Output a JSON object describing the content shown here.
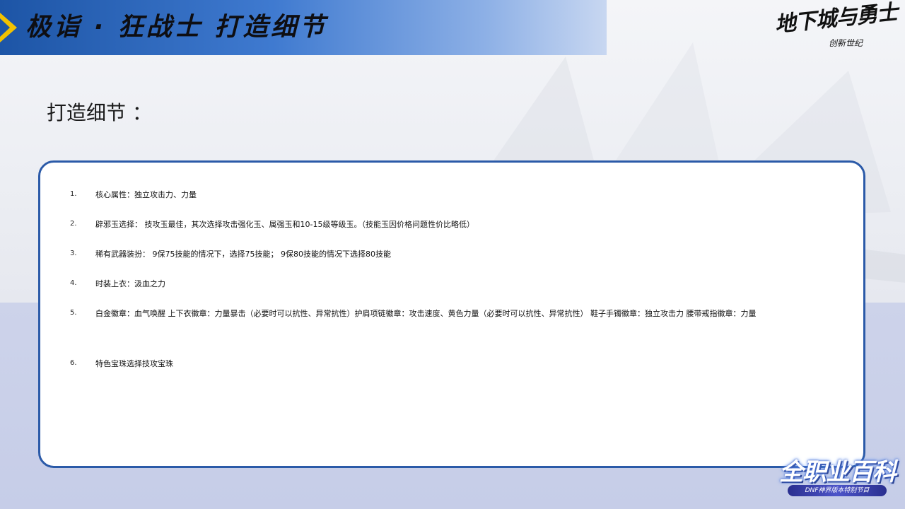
{
  "header": {
    "title": "极诣 · 狂战士  打造细节"
  },
  "logo": {
    "main": "地下城与勇士",
    "sub": "创新世纪"
  },
  "section": {
    "heading": "打造细节 ："
  },
  "items": [
    {
      "num": "1.",
      "text": "核心属性：独立攻击力、力量"
    },
    {
      "num": "2.",
      "text": "辟邪玉选择： 技攻玉最佳，其次选择攻击强化玉、属强玉和10-15级等级玉。（技能玉因价格问题性价比略低）"
    },
    {
      "num": "3.",
      "text": "稀有武器装扮： 9保75技能的情况下，选择75技能； 9保80技能的情况下选择80技能"
    },
    {
      "num": "4.",
      "text": "时装上衣：汲血之力"
    },
    {
      "num": "5.",
      "text": "白金徽章：血气唤醒 上下衣徽章：力量暴击（必要时可以抗性、异常抗性）护肩项链徽章：攻击速度、黄色力量（必要时可以抗性、异常抗性） 鞋子手镯徽章：独立攻击力  腰带戒指徽章：力量"
    },
    {
      "num": "6.",
      "text": "特色宝珠选择技攻宝珠"
    }
  ],
  "badge": {
    "main": "全职业百科",
    "sub": "DNF神界版本特别节目"
  },
  "colors": {
    "header_blue": "#1d55a6",
    "box_border": "#2b5aa8",
    "arrow_yellow": "#f2c200"
  }
}
